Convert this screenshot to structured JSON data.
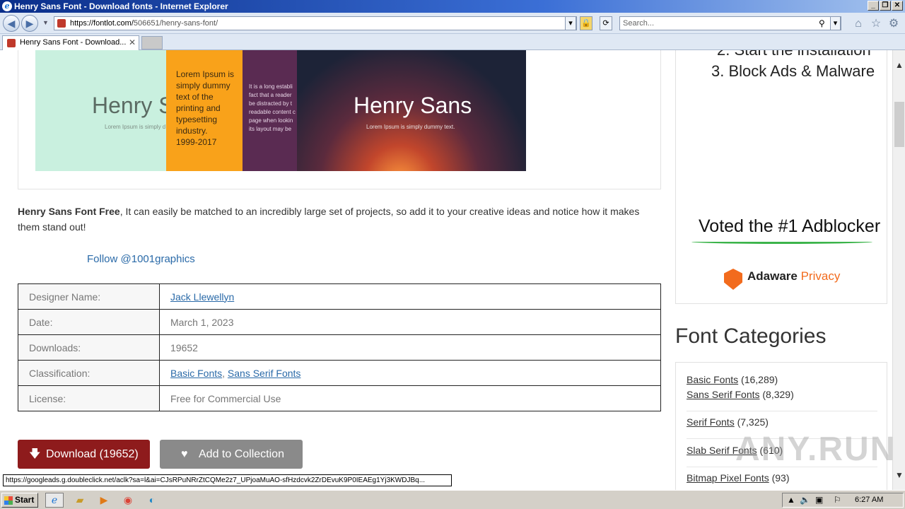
{
  "window": {
    "title": "Henry Sans Font - Download fonts - Internet Explorer",
    "min": "_",
    "restore": "❐",
    "close": "✕"
  },
  "browser": {
    "url_prefix": "https://fontlot.com/",
    "url_path": "506651/henry-sans-font/",
    "search_placeholder": "Search...",
    "tab_label": "Henry Sans Font - Download...",
    "tab_close": "✕",
    "icons": [
      "back-icon",
      "forward-icon",
      "lock-icon",
      "refresh-icon",
      "home-icon",
      "favorites-star-icon",
      "settings-gear-icon"
    ]
  },
  "preview": {
    "panel1_title": "Henry S",
    "panel1_sub": "Lorem Ipsum is simply d",
    "panel2_text": "Lorem Ipsum is simply dummy text of the printing and typesetting industry.",
    "panel2_years": "1999-2017",
    "panel3_lines": [
      "It is a long establi",
      "fact that a reader",
      "be distracted by t",
      "readable content c",
      "page when lookin",
      "its layout may be"
    ],
    "panel4_title": "Henry Sans",
    "panel4_sub": "Lorem Ipsum is simply dummy text."
  },
  "description": {
    "bold": "Henry Sans Font Free",
    "rest": ", It can easily be matched to an incredibly large set of projects, so add it to your creative ideas and notice how it makes them stand out!"
  },
  "follow_link": "Follow @1001graphics",
  "info": {
    "designer_label": "Designer Name:",
    "designer_value": "Jack Llewellyn",
    "date_label": "Date:",
    "date_value": "March 1, 2023",
    "downloads_label": "Downloads:",
    "downloads_value": "19652",
    "class_label": "Classification:",
    "class_value1": "Basic Fonts",
    "class_sep": ",",
    "class_value2": "Sans Serif Fonts",
    "license_label": "License:",
    "license_value": "Free for Commercial Use"
  },
  "buttons": {
    "download": "Download (19652)",
    "collection": "Add to Collection"
  },
  "ad": {
    "line2": "2. Start the installation",
    "line3": "3. Block Ads & Malware",
    "voted": "Voted the #1 Adblocker",
    "brand1": "Adaware",
    "brand2": " Privacy"
  },
  "categories": {
    "title": "Font Categories",
    "items": [
      {
        "name": "Basic Fonts",
        "count": "(16,289)"
      },
      {
        "name": "Sans Serif Fonts",
        "count": "(8,329)"
      },
      {
        "name": "Serif Fonts",
        "count": "(7,325)"
      },
      {
        "name": "Slab Serif Fonts",
        "count": "(610)"
      },
      {
        "name": "Bitmap Pixel Fonts",
        "count": "(93)"
      }
    ]
  },
  "status_url": "https://googleads.g.doubleclick.net/aclk?sa=l&ai=CJsRPuNRrZtCQMe2z7_UPjoaMuAO-sfHzdcvk2ZrDEvuK9P0IEAEg1Yj3KWDJBq...",
  "watermark": "ANY.RUN",
  "taskbar": {
    "start": "Start",
    "clock": "6:27 AM"
  }
}
